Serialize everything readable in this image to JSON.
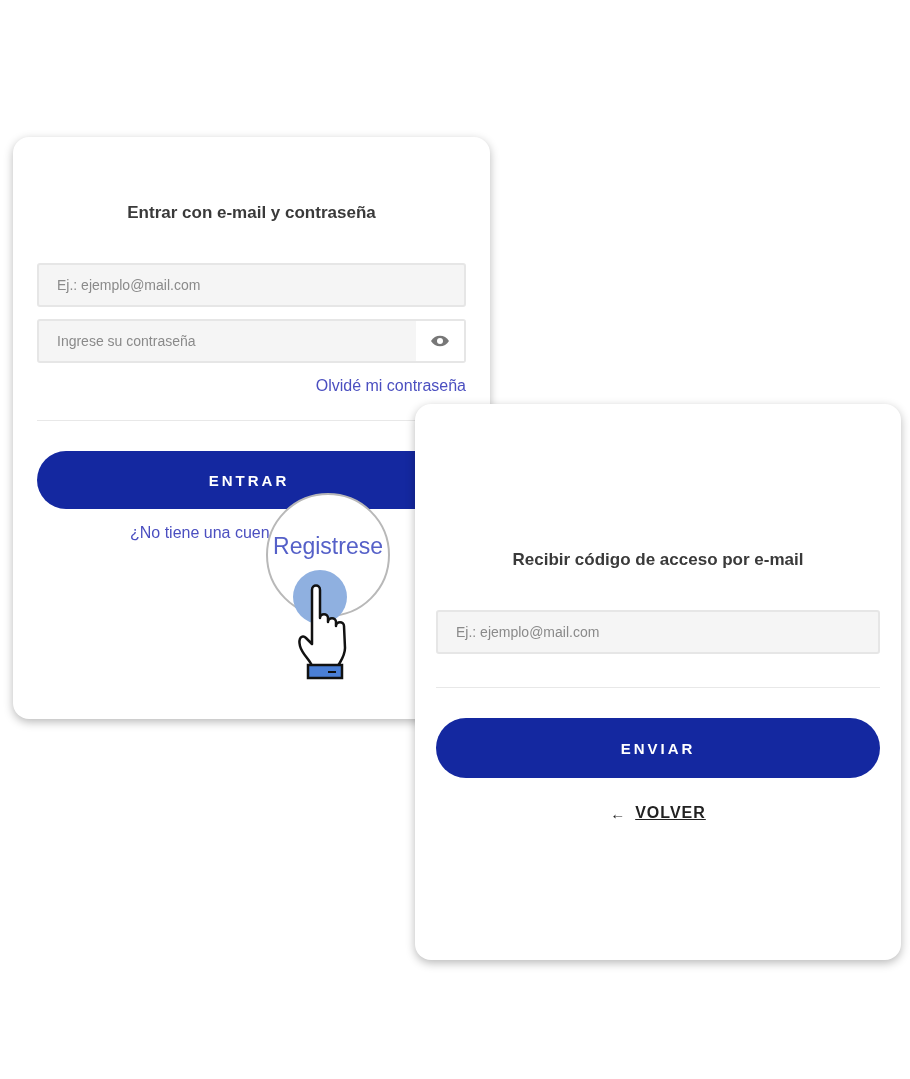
{
  "login_card": {
    "title": "Entrar con e-mail y contraseña",
    "email_field": {
      "placeholder": "Ej.: ejemplo@mail.com"
    },
    "password_field": {
      "placeholder": "Ingrese su contraseña"
    },
    "forgot_link": "Olvidé mi contraseña",
    "submit_button": "ENTRAR",
    "signup_prompt": "¿No tiene una cuen",
    "magnifier": {
      "text": "Registrese"
    }
  },
  "code_card": {
    "title": "Recibir código de acceso por e-mail",
    "email_field": {
      "placeholder": "Ej.: ejemplo@mail.com"
    },
    "submit_button": "ENVIAR",
    "back_link": {
      "arrow": "←",
      "label": "VOLVER"
    }
  }
}
